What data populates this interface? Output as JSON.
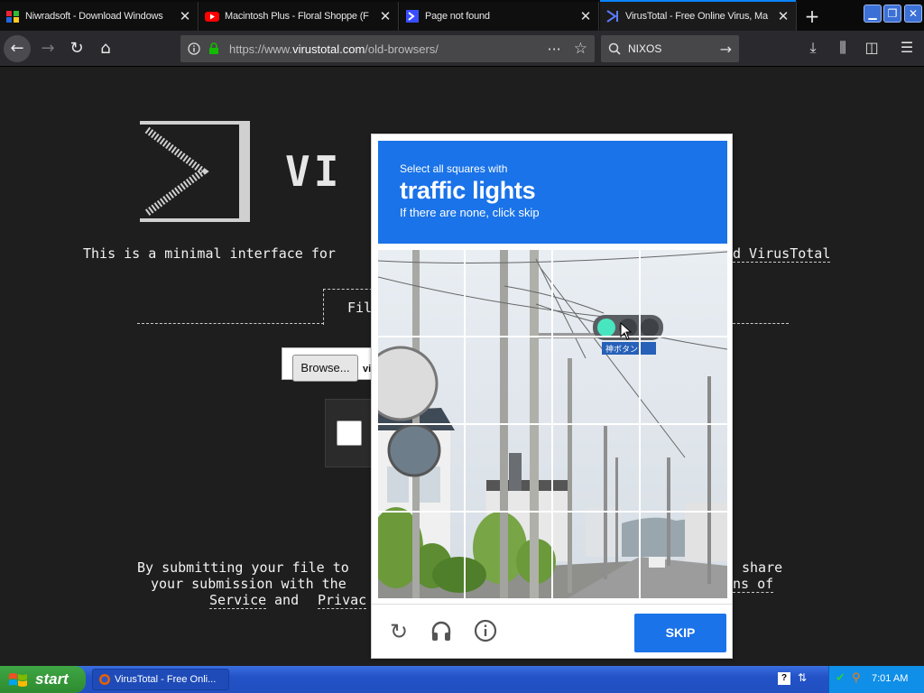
{
  "tabs": [
    {
      "title": "Niwradsoft - Download Windows",
      "icon": "niwradsoft-favicon"
    },
    {
      "title": "Macintosh Plus - Floral Shoppe (F",
      "icon": "youtube-icon"
    },
    {
      "title": "Page not found",
      "icon": "virustotal-favicon"
    },
    {
      "title": "VirusTotal - Free Online Virus, Ma",
      "icon": "virustotal-favicon",
      "active": true
    }
  ],
  "nav": {
    "url_prefix": "https://www.",
    "url_domain": "virustotal.com",
    "url_path": "/old-browsers/",
    "search_query": "NIXOS"
  },
  "page": {
    "logo_text": "VI",
    "intro_left": "This is a minimal interface for",
    "intro_right": "d VirusTotal",
    "file_label": "Fil",
    "browse_label": "Browse...",
    "file_name_stub": "vi",
    "terms_line1_left": "By submitting your file to",
    "terms_line1_right": "share",
    "terms_line2_left": "your submission with the",
    "terms_line2_right": "ns of",
    "terms_line3_left": "Service",
    "terms_line3_mid": " and ",
    "terms_line3_right": "Privac"
  },
  "challenge": {
    "instruction": "Select all squares with",
    "target": "traffic lights",
    "hint": "If there are none, click skip",
    "skip_label": "SKIP",
    "sign_text": "神ボタン"
  },
  "taskbar": {
    "start_label": "start",
    "task_item": "VirusTotal - Free Onli...",
    "clock": "7:01 AM"
  },
  "colors": {
    "accent": "#1a73e8",
    "tab_indicator": "#0a84ff",
    "page_bg": "#1e1e1e"
  }
}
